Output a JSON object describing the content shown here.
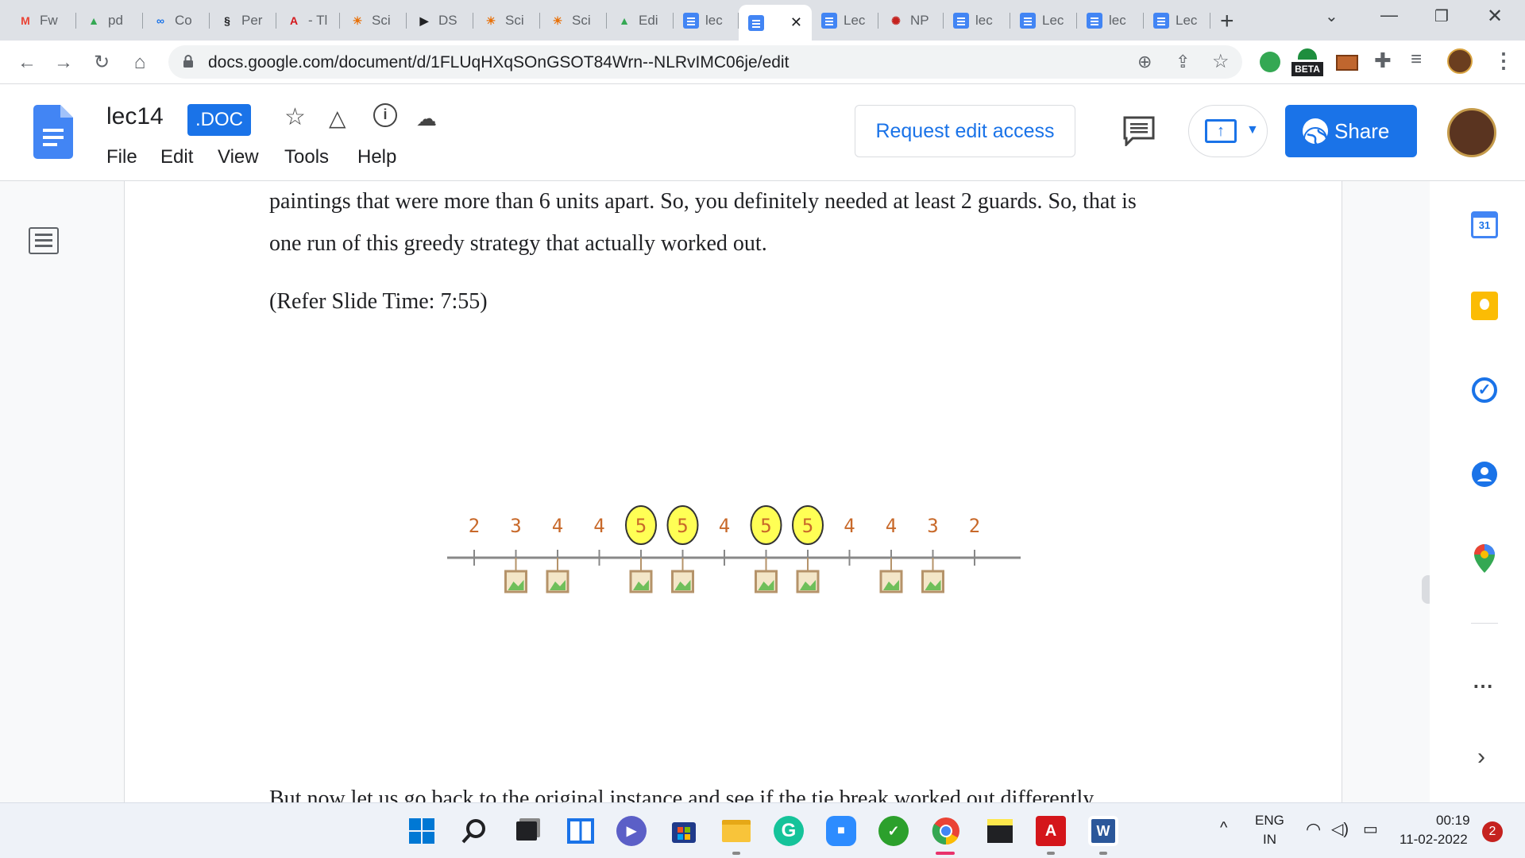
{
  "browser": {
    "tabs": [
      {
        "label": "Fw",
        "icon": "gmail-icon"
      },
      {
        "label": "pd",
        "icon": "google-drive-icon"
      },
      {
        "label": "Co",
        "icon": "link-icon"
      },
      {
        "label": "Per",
        "icon": "perplexity-icon"
      },
      {
        "label": "- Tl",
        "icon": "acrobat-icon"
      },
      {
        "label": "Sci",
        "icon": "sci-icon"
      },
      {
        "label": "DS",
        "icon": "ds-icon"
      },
      {
        "label": "Sci",
        "icon": "sci-icon"
      },
      {
        "label": "Sci",
        "icon": "sci-icon"
      },
      {
        "label": "Edi",
        "icon": "google-drive-icon"
      },
      {
        "label": "lec",
        "icon": "docs-icon"
      },
      {
        "label": "",
        "icon": "docs-icon",
        "active": true
      },
      {
        "label": "Lec",
        "icon": "docs-icon"
      },
      {
        "label": "NP",
        "icon": "nptel-icon"
      },
      {
        "label": "lec",
        "icon": "docs-icon"
      },
      {
        "label": "Lec",
        "icon": "docs-icon"
      },
      {
        "label": "lec",
        "icon": "docs-icon"
      },
      {
        "label": "Lec",
        "icon": "docs-icon"
      }
    ],
    "new_tab": "+",
    "url": "docs.google.com/document/d/1FLUqHXqSOnGSOT84Wrn--NLRvIMC06je/edit",
    "extension_badge": "BETA"
  },
  "docs": {
    "title": "lec14",
    "badge": ".DOC",
    "menu": [
      "File",
      "Edit",
      "View",
      "Tools",
      "Help"
    ],
    "request_edit": "Request edit access",
    "share": "Share"
  },
  "document": {
    "line1": "paintings that were more than 6 units apart. So, you definitely needed at least 2 guards. So, that is",
    "line2": "one run of this greedy strategy that actually worked out.",
    "slide_ref": "(Refer Slide Time: 7:55)",
    "cutoff_line": "But now let us go back to the original instance and see if the tie break worked out differently",
    "figure": {
      "numbers": [
        "2",
        "3",
        "4",
        "4",
        "5",
        "5",
        "4",
        "5",
        "5",
        "4",
        "4",
        "3",
        "2"
      ],
      "circled": [
        4,
        5,
        7,
        8
      ],
      "paintings_at": [
        1,
        2,
        4,
        5,
        7,
        8,
        10,
        11
      ]
    }
  },
  "side_panel": {
    "calendar_day": "31",
    "items": [
      "calendar-icon",
      "keep-icon",
      "tasks-icon",
      "contacts-icon",
      "maps-icon"
    ]
  },
  "taskbar": {
    "language": "ENG",
    "region": "IN",
    "time": "00:19",
    "date": "11-02-2022",
    "notifications": "2"
  },
  "colors": {
    "accent": "#1a73e8",
    "figure_number": "#c8692a",
    "circle_fill": "#ffff55"
  }
}
